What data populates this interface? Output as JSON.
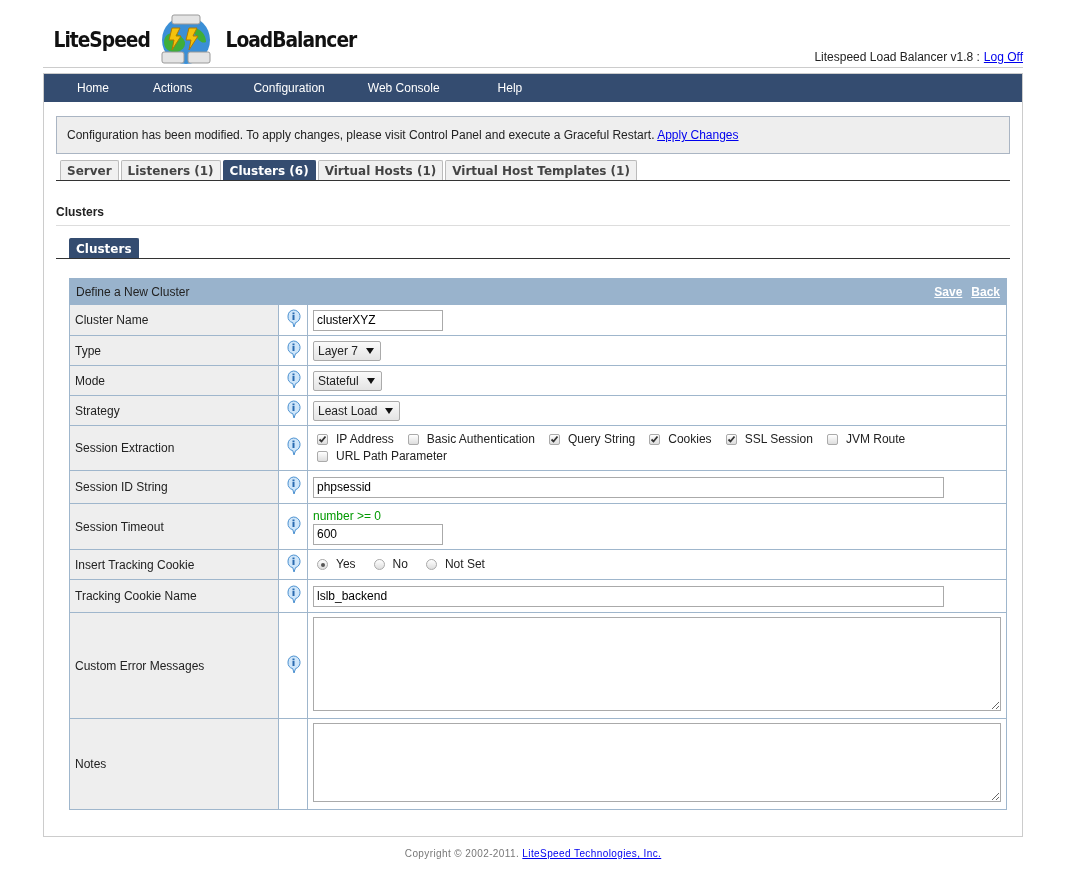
{
  "header": {
    "logo_left": "LiteSpeed",
    "logo_right": "LoadBalancer",
    "version": "Litespeed Load Balancer v1.8 :",
    "logoff": "Log Off"
  },
  "nav": [
    "Home",
    "Actions",
    "Configuration",
    "Web Console",
    "Help"
  ],
  "notice": {
    "text": "Configuration has been modified. To apply changes, please visit Control Panel and execute a Graceful Restart.",
    "link": "Apply Changes"
  },
  "tabs": [
    {
      "label": "Server",
      "selected": false
    },
    {
      "label": "Listeners (1)",
      "selected": false
    },
    {
      "label": "Clusters (6)",
      "selected": true
    },
    {
      "label": "Virtual Hosts (1)",
      "selected": false
    },
    {
      "label": "Virtual Host Templates (1)",
      "selected": false
    }
  ],
  "section_title": "Clusters",
  "subtabs": [
    {
      "label": "Clusters",
      "selected": true
    }
  ],
  "form": {
    "title": "Define a New Cluster",
    "actions": [
      "Save",
      "Back"
    ],
    "rows": [
      {
        "label": "Cluster Name",
        "info": true,
        "kind": "input",
        "value": "clusterXYZ"
      },
      {
        "label": "Type",
        "info": true,
        "kind": "select",
        "value": "Layer 7"
      },
      {
        "label": "Mode",
        "info": true,
        "kind": "select",
        "value": "Stateful"
      },
      {
        "label": "Strategy",
        "info": true,
        "kind": "select",
        "value": "Least Load"
      },
      {
        "label": "Session Extraction",
        "info": true,
        "kind": "checkboxes",
        "options": [
          {
            "label": "IP Address",
            "checked": true
          },
          {
            "label": "Basic Authentication",
            "checked": false
          },
          {
            "label": "Query String",
            "checked": true
          },
          {
            "label": "Cookies",
            "checked": true
          },
          {
            "label": "SSL Session",
            "checked": true
          },
          {
            "label": "JVM Route",
            "checked": false
          },
          {
            "label": "URL Path Parameter",
            "checked": false
          }
        ]
      },
      {
        "label": "Session ID String",
        "info": true,
        "kind": "wide-input",
        "value": "phpsessid"
      },
      {
        "label": "Session Timeout",
        "info": true,
        "kind": "input",
        "hint": "number >= 0",
        "value": "600"
      },
      {
        "label": "Insert Tracking Cookie",
        "info": true,
        "kind": "radios",
        "options": [
          {
            "label": "Yes",
            "selected": true
          },
          {
            "label": "No",
            "selected": false
          },
          {
            "label": "Not Set",
            "selected": false
          }
        ]
      },
      {
        "label": "Tracking Cookie Name",
        "info": true,
        "kind": "wide-input",
        "value": "lslb_backend"
      },
      {
        "label": "Custom Error Messages",
        "info": true,
        "kind": "textarea"
      },
      {
        "label": "Notes",
        "info": false,
        "kind": "textarea"
      }
    ]
  },
  "footer": {
    "text": "Copyright © 2002-2011.",
    "link": "LiteSpeed Technologies, Inc."
  }
}
